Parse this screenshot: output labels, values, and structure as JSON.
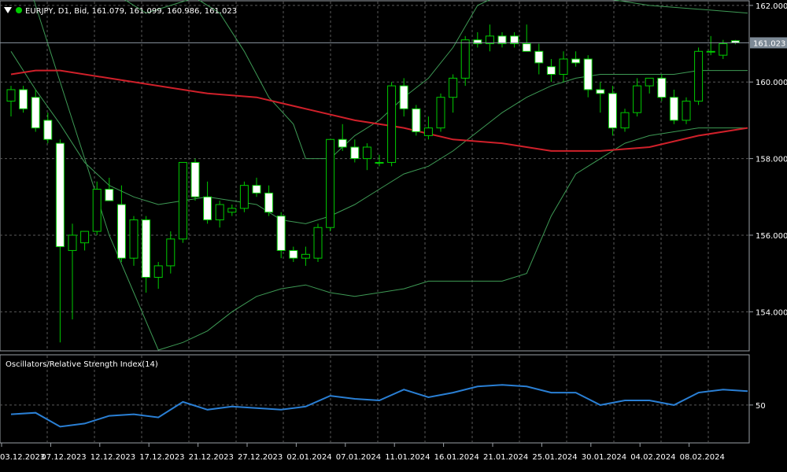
{
  "header": {
    "symbol_line": "EURJPY, D1, Bid, 161.079, 161.099, 160.986, 161.023",
    "menu_icon": "triangle-down-icon",
    "status_icon": "green-dot-icon",
    "status_color": "#00cc00"
  },
  "current_price": {
    "label": "161.023",
    "value": 161.023
  },
  "indicator": {
    "label": "Oscillators/Relative Strength Index(14)"
  },
  "colors": {
    "background": "#000000",
    "grid": "#5a5a5a",
    "candle_up_border": "#00cc00",
    "candle_down_fill": "#ffffff",
    "bollinger": "#3e9a55",
    "ma": "#d0202a",
    "rsi": "#2a7fd4",
    "price_line": "#8a96a0"
  },
  "chart_data": [
    {
      "type": "candlestick",
      "title": "EURJPY, D1",
      "yticks": [
        "162.000",
        "160.000",
        "158.000",
        "156.000",
        "154.000"
      ],
      "ylim": [
        153.0,
        162.1
      ],
      "xtick_labels": [
        "03.12.2023",
        "07.12.2023",
        "12.12.2023",
        "17.12.2023",
        "21.12.2023",
        "27.12.2023",
        "02.01.2024",
        "07.01.2024",
        "11.01.2024",
        "16.01.2024",
        "21.01.2024",
        "25.01.2024",
        "30.01.2024",
        "04.02.2024",
        "08.02.2024"
      ],
      "xtick_index": [
        0,
        4,
        8,
        12,
        16,
        20,
        24,
        28,
        32,
        36,
        40,
        44,
        48,
        52,
        56
      ],
      "candles": [
        {
          "o": 159.5,
          "h": 159.9,
          "l": 159.1,
          "c": 159.8
        },
        {
          "o": 159.8,
          "h": 159.9,
          "l": 159.2,
          "c": 159.3
        },
        {
          "o": 159.6,
          "h": 159.8,
          "l": 158.7,
          "c": 158.8
        },
        {
          "o": 159.0,
          "h": 159.2,
          "l": 158.4,
          "c": 158.5
        },
        {
          "o": 158.4,
          "h": 158.5,
          "l": 153.2,
          "c": 155.7
        },
        {
          "o": 155.6,
          "h": 156.3,
          "l": 153.8,
          "c": 156.0
        },
        {
          "o": 155.8,
          "h": 156.1,
          "l": 155.6,
          "c": 156.1
        },
        {
          "o": 156.1,
          "h": 157.4,
          "l": 156.0,
          "c": 157.2
        },
        {
          "o": 157.2,
          "h": 157.5,
          "l": 157.0,
          "c": 156.9
        },
        {
          "o": 156.8,
          "h": 157.3,
          "l": 155.3,
          "c": 155.4
        },
        {
          "o": 155.4,
          "h": 156.5,
          "l": 155.2,
          "c": 156.4
        },
        {
          "o": 156.4,
          "h": 156.5,
          "l": 154.5,
          "c": 154.9
        },
        {
          "o": 154.9,
          "h": 155.3,
          "l": 154.6,
          "c": 155.2
        },
        {
          "o": 155.2,
          "h": 156.1,
          "l": 155.0,
          "c": 155.9
        },
        {
          "o": 155.9,
          "h": 157.9,
          "l": 155.8,
          "c": 157.9
        },
        {
          "o": 157.9,
          "h": 158.0,
          "l": 156.9,
          "c": 157.0
        },
        {
          "o": 157.0,
          "h": 157.4,
          "l": 156.3,
          "c": 156.4
        },
        {
          "o": 156.4,
          "h": 156.9,
          "l": 156.2,
          "c": 156.8
        },
        {
          "o": 156.6,
          "h": 156.8,
          "l": 156.5,
          "c": 156.7
        },
        {
          "o": 156.7,
          "h": 157.4,
          "l": 156.6,
          "c": 157.3
        },
        {
          "o": 157.3,
          "h": 157.5,
          "l": 157.0,
          "c": 157.1
        },
        {
          "o": 157.1,
          "h": 157.3,
          "l": 156.5,
          "c": 156.6
        },
        {
          "o": 156.5,
          "h": 156.6,
          "l": 155.4,
          "c": 155.6
        },
        {
          "o": 155.6,
          "h": 155.7,
          "l": 155.3,
          "c": 155.4
        },
        {
          "o": 155.4,
          "h": 155.7,
          "l": 155.2,
          "c": 155.5
        },
        {
          "o": 155.4,
          "h": 156.3,
          "l": 155.3,
          "c": 156.2
        },
        {
          "o": 156.2,
          "h": 158.5,
          "l": 156.1,
          "c": 158.5
        },
        {
          "o": 158.5,
          "h": 158.9,
          "l": 158.2,
          "c": 158.3
        },
        {
          "o": 158.3,
          "h": 158.5,
          "l": 157.9,
          "c": 158.0
        },
        {
          "o": 158.0,
          "h": 158.4,
          "l": 157.7,
          "c": 158.3
        },
        {
          "o": 157.9,
          "h": 158.1,
          "l": 157.8,
          "c": 157.9
        },
        {
          "o": 157.9,
          "h": 160.0,
          "l": 157.8,
          "c": 159.9
        },
        {
          "o": 159.9,
          "h": 160.1,
          "l": 159.1,
          "c": 159.3
        },
        {
          "o": 159.3,
          "h": 159.4,
          "l": 158.6,
          "c": 158.7
        },
        {
          "o": 158.6,
          "h": 159.1,
          "l": 158.5,
          "c": 158.8
        },
        {
          "o": 158.8,
          "h": 159.7,
          "l": 158.7,
          "c": 159.6
        },
        {
          "o": 159.6,
          "h": 160.2,
          "l": 159.2,
          "c": 160.1
        },
        {
          "o": 160.1,
          "h": 161.2,
          "l": 159.9,
          "c": 161.1
        },
        {
          "o": 161.1,
          "h": 161.3,
          "l": 160.9,
          "c": 161.0
        },
        {
          "o": 161.0,
          "h": 161.5,
          "l": 160.8,
          "c": 161.2
        },
        {
          "o": 161.2,
          "h": 161.3,
          "l": 160.9,
          "c": 161.0
        },
        {
          "o": 161.2,
          "h": 161.3,
          "l": 160.9,
          "c": 161.0
        },
        {
          "o": 161.0,
          "h": 161.5,
          "l": 160.8,
          "c": 160.8
        },
        {
          "o": 160.8,
          "h": 161.0,
          "l": 160.2,
          "c": 160.5
        },
        {
          "o": 160.4,
          "h": 160.6,
          "l": 160.0,
          "c": 160.2
        },
        {
          "o": 160.2,
          "h": 160.8,
          "l": 160.0,
          "c": 160.6
        },
        {
          "o": 160.6,
          "h": 160.8,
          "l": 160.4,
          "c": 160.5
        },
        {
          "o": 160.6,
          "h": 160.7,
          "l": 159.6,
          "c": 159.8
        },
        {
          "o": 159.8,
          "h": 160.0,
          "l": 159.2,
          "c": 159.7
        },
        {
          "o": 159.7,
          "h": 159.9,
          "l": 158.6,
          "c": 158.8
        },
        {
          "o": 158.8,
          "h": 159.3,
          "l": 158.7,
          "c": 159.2
        },
        {
          "o": 159.2,
          "h": 160.1,
          "l": 159.1,
          "c": 159.9
        },
        {
          "o": 159.9,
          "h": 160.1,
          "l": 159.7,
          "c": 160.1
        },
        {
          "o": 160.1,
          "h": 160.2,
          "l": 159.5,
          "c": 159.6
        },
        {
          "o": 159.6,
          "h": 159.8,
          "l": 158.9,
          "c": 159.0
        },
        {
          "o": 159.0,
          "h": 159.6,
          "l": 158.9,
          "c": 159.5
        },
        {
          "o": 159.5,
          "h": 160.9,
          "l": 159.4,
          "c": 160.8
        },
        {
          "o": 160.8,
          "h": 161.2,
          "l": 160.7,
          "c": 160.8
        },
        {
          "o": 160.7,
          "h": 161.1,
          "l": 160.6,
          "c": 161.0
        },
        {
          "o": 161.079,
          "h": 161.099,
          "l": 160.986,
          "c": 161.023
        }
      ],
      "bollinger_upper": [
        {
          "x": 0,
          "y": 165.0
        },
        {
          "x": 4,
          "y": 163.3
        },
        {
          "x": 7,
          "y": 162.6
        },
        {
          "x": 9,
          "y": 162.2
        },
        {
          "x": 11,
          "y": 161.8
        },
        {
          "x": 13,
          "y": 162.0
        },
        {
          "x": 15,
          "y": 162.2
        },
        {
          "x": 17,
          "y": 161.8
        },
        {
          "x": 19,
          "y": 160.8
        },
        {
          "x": 21,
          "y": 159.6
        },
        {
          "x": 23,
          "y": 158.9
        },
        {
          "x": 24,
          "y": 158.0
        },
        {
          "x": 26,
          "y": 158.0
        },
        {
          "x": 28,
          "y": 158.6
        },
        {
          "x": 30,
          "y": 159.0
        },
        {
          "x": 32,
          "y": 159.6
        },
        {
          "x": 34,
          "y": 160.1
        },
        {
          "x": 36,
          "y": 160.9
        },
        {
          "x": 38,
          "y": 162.0
        },
        {
          "x": 40,
          "y": 162.3
        },
        {
          "x": 44,
          "y": 162.3
        },
        {
          "x": 48,
          "y": 162.2
        },
        {
          "x": 52,
          "y": 162.0
        },
        {
          "x": 56,
          "y": 161.9
        },
        {
          "x": 60,
          "y": 161.8
        }
      ],
      "bollinger_mid": [
        {
          "x": 0,
          "y": 160.8
        },
        {
          "x": 2,
          "y": 159.8
        },
        {
          "x": 4,
          "y": 158.9
        },
        {
          "x": 6,
          "y": 157.9
        },
        {
          "x": 8,
          "y": 157.3
        },
        {
          "x": 10,
          "y": 157.0
        },
        {
          "x": 12,
          "y": 156.8
        },
        {
          "x": 14,
          "y": 156.9
        },
        {
          "x": 16,
          "y": 157.0
        },
        {
          "x": 18,
          "y": 156.9
        },
        {
          "x": 20,
          "y": 156.8
        },
        {
          "x": 22,
          "y": 156.4
        },
        {
          "x": 24,
          "y": 156.3
        },
        {
          "x": 26,
          "y": 156.5
        },
        {
          "x": 28,
          "y": 156.8
        },
        {
          "x": 30,
          "y": 157.2
        },
        {
          "x": 32,
          "y": 157.6
        },
        {
          "x": 34,
          "y": 157.8
        },
        {
          "x": 36,
          "y": 158.2
        },
        {
          "x": 38,
          "y": 158.7
        },
        {
          "x": 40,
          "y": 159.2
        },
        {
          "x": 42,
          "y": 159.6
        },
        {
          "x": 44,
          "y": 159.9
        },
        {
          "x": 46,
          "y": 160.1
        },
        {
          "x": 48,
          "y": 160.2
        },
        {
          "x": 50,
          "y": 160.2
        },
        {
          "x": 52,
          "y": 160.2
        },
        {
          "x": 54,
          "y": 160.2
        },
        {
          "x": 56,
          "y": 160.3
        },
        {
          "x": 60,
          "y": 160.3
        }
      ],
      "bollinger_lower": [
        {
          "x": 0,
          "y": 164.0
        },
        {
          "x": 6,
          "y": 158.0
        },
        {
          "x": 8,
          "y": 156.0
        },
        {
          "x": 10,
          "y": 154.5
        },
        {
          "x": 12,
          "y": 153.0
        },
        {
          "x": 14,
          "y": 153.2
        },
        {
          "x": 16,
          "y": 153.5
        },
        {
          "x": 18,
          "y": 154.0
        },
        {
          "x": 20,
          "y": 154.4
        },
        {
          "x": 22,
          "y": 154.6
        },
        {
          "x": 24,
          "y": 154.7
        },
        {
          "x": 26,
          "y": 154.5
        },
        {
          "x": 28,
          "y": 154.4
        },
        {
          "x": 30,
          "y": 154.5
        },
        {
          "x": 32,
          "y": 154.6
        },
        {
          "x": 34,
          "y": 154.8
        },
        {
          "x": 36,
          "y": 154.8
        },
        {
          "x": 38,
          "y": 154.8
        },
        {
          "x": 40,
          "y": 154.8
        },
        {
          "x": 42,
          "y": 155.0
        },
        {
          "x": 44,
          "y": 156.5
        },
        {
          "x": 46,
          "y": 157.6
        },
        {
          "x": 48,
          "y": 158.0
        },
        {
          "x": 50,
          "y": 158.4
        },
        {
          "x": 52,
          "y": 158.6
        },
        {
          "x": 54,
          "y": 158.7
        },
        {
          "x": 56,
          "y": 158.8
        },
        {
          "x": 60,
          "y": 158.8
        }
      ],
      "moving_average": [
        {
          "x": 0,
          "y": 160.2
        },
        {
          "x": 2,
          "y": 160.3
        },
        {
          "x": 4,
          "y": 160.3
        },
        {
          "x": 8,
          "y": 160.1
        },
        {
          "x": 12,
          "y": 159.9
        },
        {
          "x": 16,
          "y": 159.7
        },
        {
          "x": 20,
          "y": 159.6
        },
        {
          "x": 24,
          "y": 159.3
        },
        {
          "x": 28,
          "y": 159.0
        },
        {
          "x": 32,
          "y": 158.8
        },
        {
          "x": 36,
          "y": 158.5
        },
        {
          "x": 40,
          "y": 158.4
        },
        {
          "x": 44,
          "y": 158.2
        },
        {
          "x": 48,
          "y": 158.2
        },
        {
          "x": 52,
          "y": 158.3
        },
        {
          "x": 56,
          "y": 158.6
        },
        {
          "x": 60,
          "y": 158.8
        }
      ]
    },
    {
      "type": "line",
      "title": "Oscillators/Relative Strength Index(14)",
      "yticks": [
        "50"
      ],
      "ylim": [
        38,
        66
      ],
      "series": [
        {
          "name": "Relative Strength Index(14)",
          "points": [
            {
              "x": 0,
              "y": 47
            },
            {
              "x": 2,
              "y": 47.5
            },
            {
              "x": 4,
              "y": 43
            },
            {
              "x": 6,
              "y": 44
            },
            {
              "x": 8,
              "y": 46.5
            },
            {
              "x": 10,
              "y": 47
            },
            {
              "x": 12,
              "y": 46
            },
            {
              "x": 14,
              "y": 51
            },
            {
              "x": 16,
              "y": 48.5
            },
            {
              "x": 18,
              "y": 49.5
            },
            {
              "x": 20,
              "y": 49
            },
            {
              "x": 22,
              "y": 48.5
            },
            {
              "x": 24,
              "y": 49.5
            },
            {
              "x": 26,
              "y": 53
            },
            {
              "x": 28,
              "y": 52
            },
            {
              "x": 30,
              "y": 51.5
            },
            {
              "x": 32,
              "y": 55
            },
            {
              "x": 34,
              "y": 52.5
            },
            {
              "x": 36,
              "y": 54
            },
            {
              "x": 38,
              "y": 56
            },
            {
              "x": 40,
              "y": 56.5
            },
            {
              "x": 42,
              "y": 56
            },
            {
              "x": 44,
              "y": 54
            },
            {
              "x": 46,
              "y": 54
            },
            {
              "x": 48,
              "y": 50
            },
            {
              "x": 50,
              "y": 51.5
            },
            {
              "x": 52,
              "y": 51.5
            },
            {
              "x": 54,
              "y": 50
            },
            {
              "x": 56,
              "y": 54
            },
            {
              "x": 58,
              "y": 55
            },
            {
              "x": 60,
              "y": 54.5
            }
          ]
        }
      ]
    }
  ]
}
